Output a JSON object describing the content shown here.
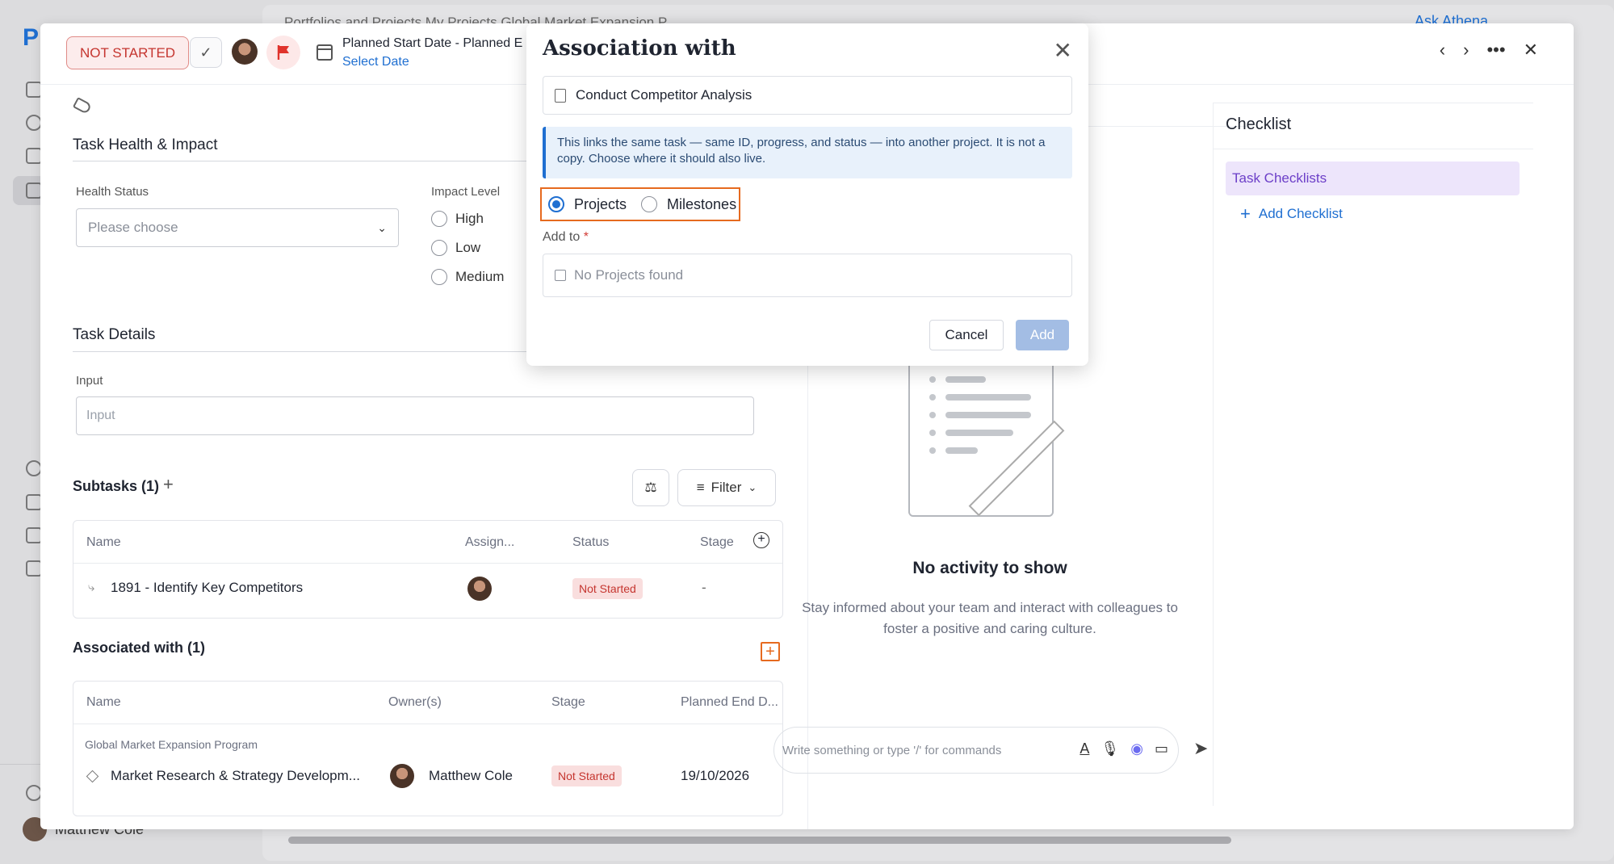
{
  "background": {
    "breadcrumb": "Portfolios and Projects    My Projects    Global Market Expansion P...",
    "ask_label": "Ask Athena",
    "user_name": "Matthew Cole"
  },
  "topbar": {
    "status": "NOT STARTED",
    "date_label": "Planned Start Date - Planned E",
    "date_link": "Select Date"
  },
  "health": {
    "section_title": "Task Health & Impact",
    "health_label": "Health Status",
    "health_placeholder": "Please choose",
    "impact_label": "Impact Level",
    "impact_options": [
      "High",
      "Low",
      "Medium"
    ]
  },
  "details": {
    "section_title": "Task Details",
    "input_label": "Input",
    "input_placeholder": "Input"
  },
  "subtasks": {
    "title": "Subtasks (1)",
    "filter_label": "Filter",
    "columns": [
      "Name",
      "Assign...",
      "Status",
      "Stage"
    ],
    "rows": [
      {
        "name": "1891 - Identify Key Competitors",
        "status": "Not Started",
        "stage": "-"
      }
    ]
  },
  "associated": {
    "title": "Associated with (1)",
    "columns": [
      "Name",
      "Owner(s)",
      "Stage",
      "Planned End D..."
    ],
    "group": "Global Market Expansion Program",
    "rows": [
      {
        "name": "Market Research & Strategy Developm...",
        "owner": "Matthew Cole",
        "stage": "Not Started",
        "end_date": "19/10/2026"
      }
    ]
  },
  "activity": {
    "empty_title": "No activity to show",
    "empty_sub": "Stay informed about your team and interact with colleagues to foster a positive and caring culture.",
    "comment_placeholder": "Write something or type '/' for commands"
  },
  "checklist": {
    "title": "Checklist",
    "item": "Task Checklists",
    "add_label": "Add Checklist"
  },
  "modal": {
    "title": "Association with",
    "task_name": "Conduct Competitor Analysis",
    "info": "This links the same task — same ID, progress, and status — into another project. It is not a copy. Choose where it should also live.",
    "radio_projects": "Projects",
    "radio_milestones": "Milestones",
    "selected": "Projects",
    "add_to_label": "Add to",
    "required_mark": "*",
    "select_placeholder": "No Projects found",
    "cancel_label": "Cancel",
    "add_label": "Add"
  },
  "colors": {
    "accent": "#1f6fd1",
    "highlight": "#e66a1f",
    "status_red": "#c5352f",
    "checklist_purple": "#6c3fc8"
  }
}
